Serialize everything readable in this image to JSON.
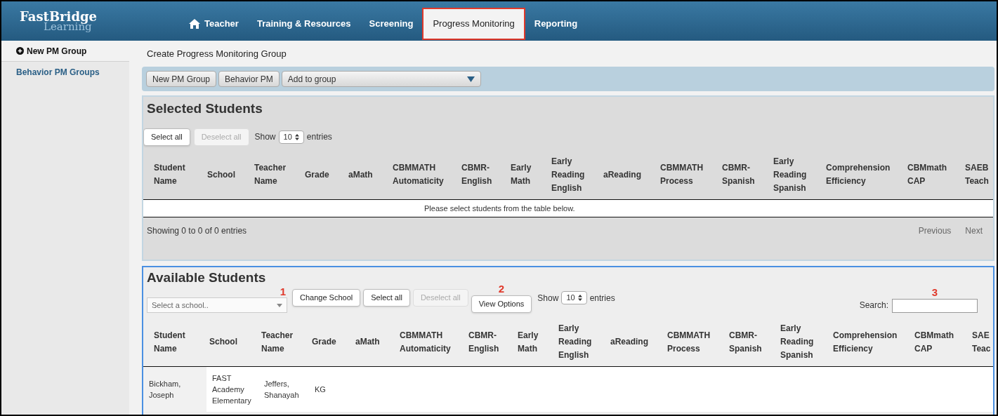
{
  "logo": {
    "line1": "FastBridge",
    "line2": "Learning"
  },
  "nav": [
    {
      "label": "Teacher",
      "selected": false
    },
    {
      "label": "Training & Resources",
      "selected": false
    },
    {
      "label": "Screening",
      "selected": false
    },
    {
      "label": "Progress Monitoring",
      "selected": true
    },
    {
      "label": "Reporting",
      "selected": false
    }
  ],
  "sidebar": {
    "items": [
      {
        "label": "New PM Group",
        "selected": true
      },
      {
        "label": "Behavior PM Groups",
        "selected": false
      }
    ]
  },
  "page_title": "Create Progress Monitoring Group",
  "toolbar": {
    "buttons": [
      "New PM Group",
      "Behavior PM"
    ],
    "dropdown": "Add to group"
  },
  "selected_students": {
    "title": "Selected Students",
    "select_all": {
      "label": "Select all",
      "disabled": false
    },
    "deselect_all": {
      "label": "Deselect all",
      "disabled": true
    },
    "show": "Show",
    "entries_value": "10",
    "entries": "entries",
    "columns": [
      "Student\nName",
      "School",
      "Teacher\nName",
      "Grade",
      "aMath",
      "CBMMATH\nAutomaticity",
      "CBMR-\nEnglish",
      "Early\nMath",
      "Early\nReading\nEnglish",
      "aReading",
      "CBMMATH\nProcess",
      "CBMR-\nSpanish",
      "Early\nReading\nSpanish",
      "Comprehension\nEfficiency",
      "CBMmath\nCAP",
      "SAEB\nTeach"
    ],
    "empty_message": "Please select students from the table below.",
    "info": "Showing 0 to 0 of 0 entries",
    "previous": "Previous",
    "next": "Next"
  },
  "available_students": {
    "title": "Available Students",
    "school_select": {
      "placeholder": "Select a school.."
    },
    "change_school": "Change School",
    "select_all": {
      "label": "Select all",
      "disabled": false
    },
    "deselect_all": {
      "label": "Deselect all",
      "disabled": true
    },
    "view_options": "View Options",
    "show": "Show",
    "entries_value": "10",
    "entries": "entries",
    "search_label": "Search:",
    "annotations": [
      "1",
      "2",
      "3"
    ],
    "columns": [
      "Student\nName",
      "School",
      "Teacher\nName",
      "Grade",
      "aMath",
      "CBMMATH\nAutomaticity",
      "CBMR-\nEnglish",
      "Early\nMath",
      "Early\nReading\nEnglish",
      "aReading",
      "CBMMATH\nProcess",
      "CBMR-\nSpanish",
      "Early\nReading\nSpanish",
      "Comprehension\nEfficiency",
      "CBMmath\nCAP",
      "SAE\nTeac"
    ],
    "rows": [
      [
        "Bickham,\nJoseph",
        "FAST\nAcademy\nElementary",
        "Jeffers,\nShanayah",
        "KG"
      ]
    ]
  }
}
